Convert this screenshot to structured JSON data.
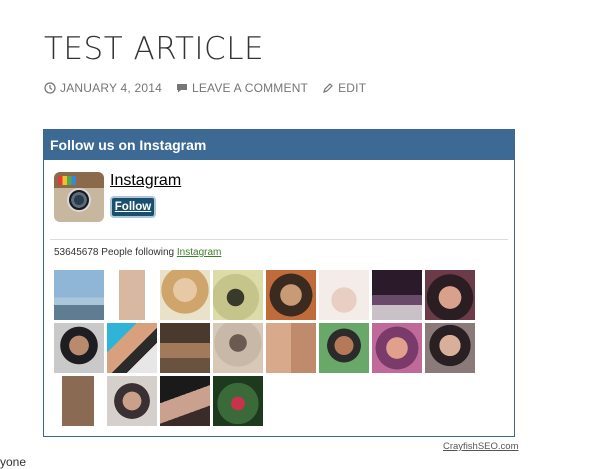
{
  "article": {
    "title": "TEST ARTICLE",
    "date": "JANUARY 4, 2014",
    "comment_link": "LEAVE A COMMENT",
    "edit_link": "EDIT"
  },
  "widget": {
    "heading": "Follow us on Instagram",
    "profile_name": "Instagram",
    "follow_label": "Follow",
    "followers_count": "53645678",
    "followers_text": "People following",
    "followers_link": "Instagram",
    "photos": [
      {
        "icon": "photo-1"
      },
      {
        "icon": "photo-2"
      },
      {
        "icon": "photo-3"
      },
      {
        "icon": "photo-4"
      },
      {
        "icon": "photo-5"
      },
      {
        "icon": "photo-6"
      },
      {
        "icon": "photo-7"
      },
      {
        "icon": "photo-8"
      },
      {
        "icon": "photo-9"
      },
      {
        "icon": "photo-10"
      },
      {
        "icon": "photo-11"
      },
      {
        "icon": "photo-12"
      },
      {
        "icon": "photo-13"
      },
      {
        "icon": "photo-14"
      },
      {
        "icon": "photo-15"
      },
      {
        "icon": "photo-16"
      },
      {
        "icon": "photo-17"
      },
      {
        "icon": "photo-18"
      },
      {
        "icon": "photo-19"
      },
      {
        "icon": "photo-20"
      }
    ]
  },
  "footer": {
    "credit": "CrayfishSEO.com",
    "truncated_text": "yone"
  },
  "colors": {
    "widget_header": "#3d6a94",
    "follow_button": "#1b4f6e",
    "link_green": "#3f7d2a"
  }
}
